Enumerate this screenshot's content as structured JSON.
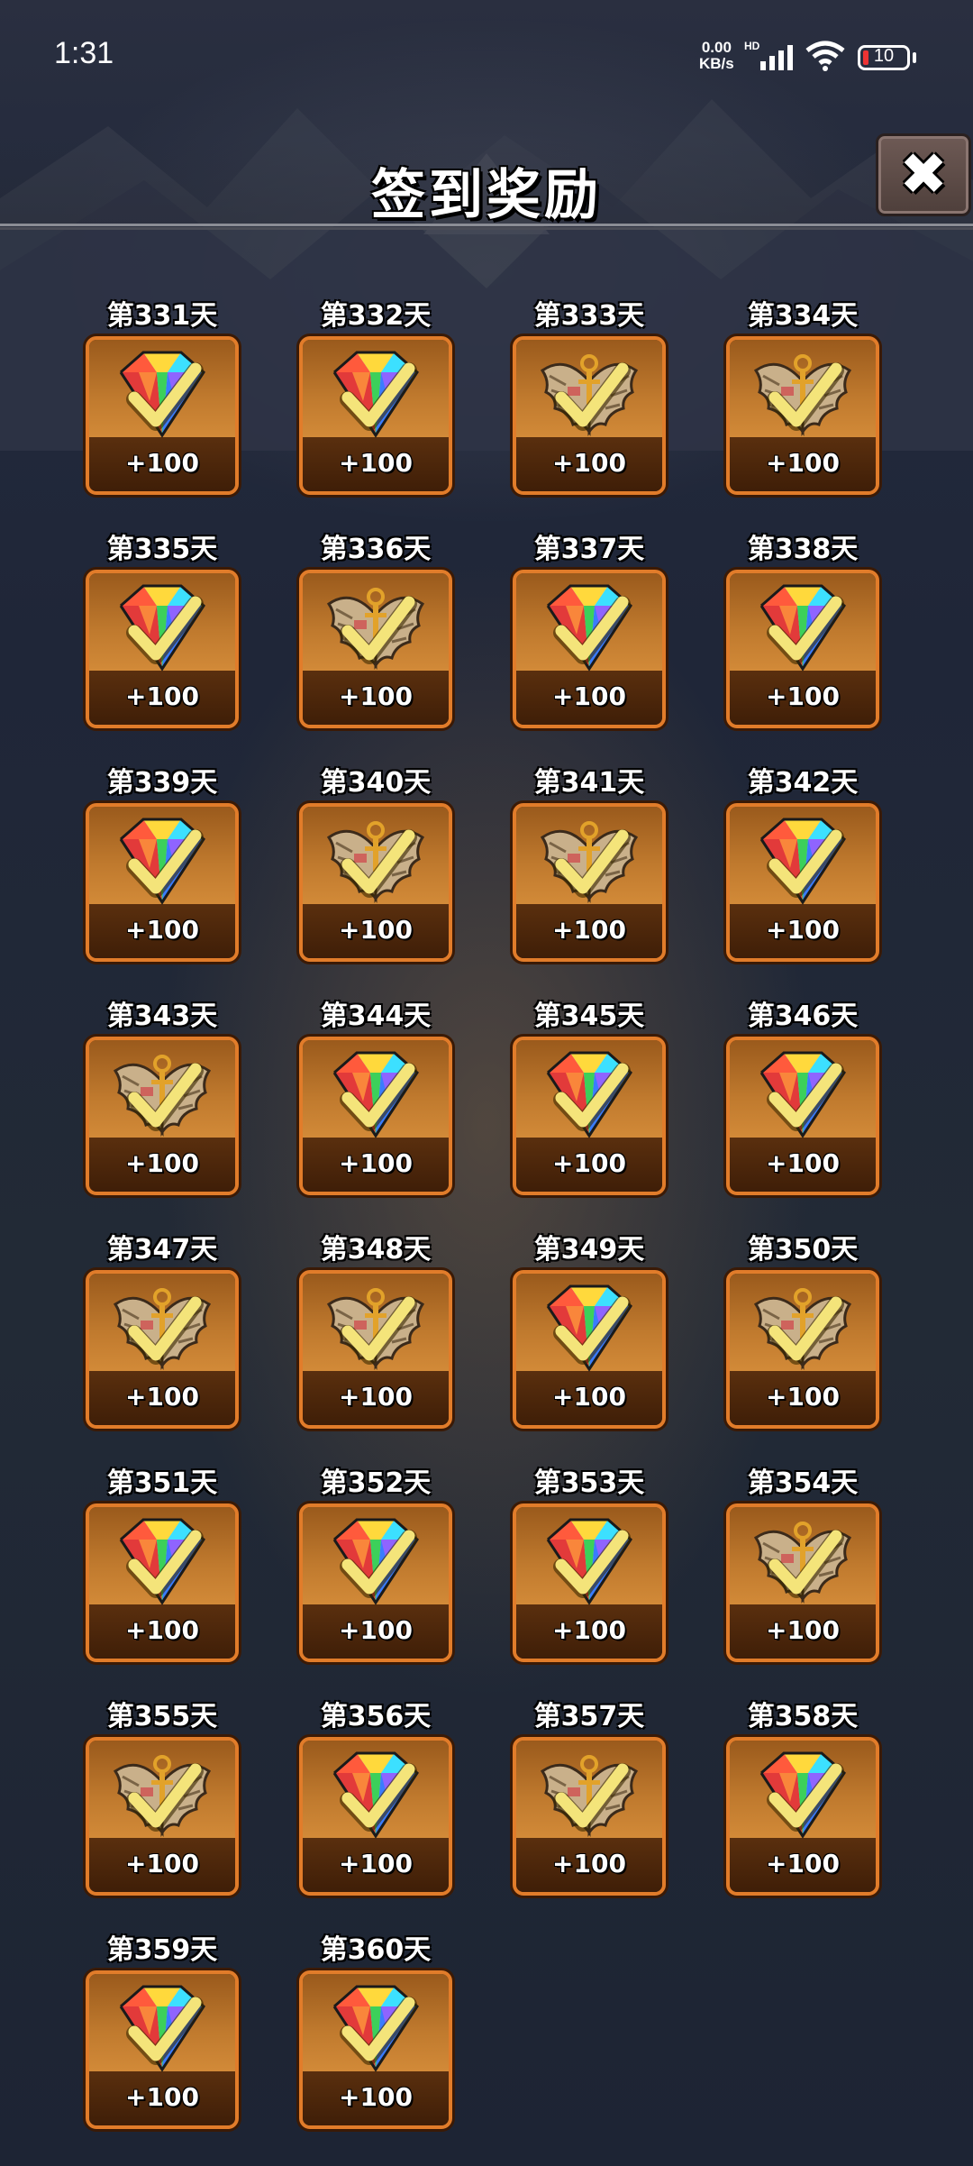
{
  "status_bar": {
    "time": "1:31",
    "net_speed_value": "0.00",
    "net_speed_unit": "KB/s",
    "network_type": "HD",
    "battery_level": "10",
    "signal_icon": "signal-bars-icon",
    "wifi_icon": "wifi-icon",
    "battery_icon": "battery-icon"
  },
  "header": {
    "title": "签到奖励",
    "close_icon": "close-icon",
    "close_glyph": "✖"
  },
  "colors": {
    "card_border": "#e17c2a",
    "card_top": "#c07a2e",
    "card_bottom": "#3d1d07",
    "check": "#f4e47a"
  },
  "rewards": [
    {
      "day": "第331天",
      "reward": "diamond",
      "amount": "+100",
      "claimed": true
    },
    {
      "day": "第332天",
      "reward": "diamond",
      "amount": "+100",
      "claimed": true
    },
    {
      "day": "第333天",
      "reward": "winged-emblem",
      "amount": "+100",
      "claimed": true
    },
    {
      "day": "第334天",
      "reward": "winged-emblem",
      "amount": "+100",
      "claimed": true
    },
    {
      "day": "第335天",
      "reward": "diamond",
      "amount": "+100",
      "claimed": true
    },
    {
      "day": "第336天",
      "reward": "winged-emblem",
      "amount": "+100",
      "claimed": true
    },
    {
      "day": "第337天",
      "reward": "diamond",
      "amount": "+100",
      "claimed": true
    },
    {
      "day": "第338天",
      "reward": "diamond",
      "amount": "+100",
      "claimed": true
    },
    {
      "day": "第339天",
      "reward": "diamond",
      "amount": "+100",
      "claimed": true
    },
    {
      "day": "第340天",
      "reward": "winged-emblem",
      "amount": "+100",
      "claimed": true
    },
    {
      "day": "第341天",
      "reward": "winged-emblem",
      "amount": "+100",
      "claimed": true
    },
    {
      "day": "第342天",
      "reward": "diamond",
      "amount": "+100",
      "claimed": true
    },
    {
      "day": "第343天",
      "reward": "winged-emblem",
      "amount": "+100",
      "claimed": true
    },
    {
      "day": "第344天",
      "reward": "diamond",
      "amount": "+100",
      "claimed": true
    },
    {
      "day": "第345天",
      "reward": "diamond",
      "amount": "+100",
      "claimed": true
    },
    {
      "day": "第346天",
      "reward": "diamond",
      "amount": "+100",
      "claimed": true
    },
    {
      "day": "第347天",
      "reward": "winged-emblem",
      "amount": "+100",
      "claimed": true
    },
    {
      "day": "第348天",
      "reward": "winged-emblem",
      "amount": "+100",
      "claimed": true
    },
    {
      "day": "第349天",
      "reward": "diamond",
      "amount": "+100",
      "claimed": true
    },
    {
      "day": "第350天",
      "reward": "winged-emblem",
      "amount": "+100",
      "claimed": true
    },
    {
      "day": "第351天",
      "reward": "diamond",
      "amount": "+100",
      "claimed": true
    },
    {
      "day": "第352天",
      "reward": "diamond",
      "amount": "+100",
      "claimed": true
    },
    {
      "day": "第353天",
      "reward": "diamond",
      "amount": "+100",
      "claimed": true
    },
    {
      "day": "第354天",
      "reward": "winged-emblem",
      "amount": "+100",
      "claimed": true
    },
    {
      "day": "第355天",
      "reward": "winged-emblem",
      "amount": "+100",
      "claimed": true
    },
    {
      "day": "第356天",
      "reward": "diamond",
      "amount": "+100",
      "claimed": true
    },
    {
      "day": "第357天",
      "reward": "winged-emblem",
      "amount": "+100",
      "claimed": true
    },
    {
      "day": "第358天",
      "reward": "diamond",
      "amount": "+100",
      "claimed": true
    },
    {
      "day": "第359天",
      "reward": "diamond",
      "amount": "+100",
      "claimed": true
    },
    {
      "day": "第360天",
      "reward": "diamond",
      "amount": "+100",
      "claimed": true
    }
  ]
}
